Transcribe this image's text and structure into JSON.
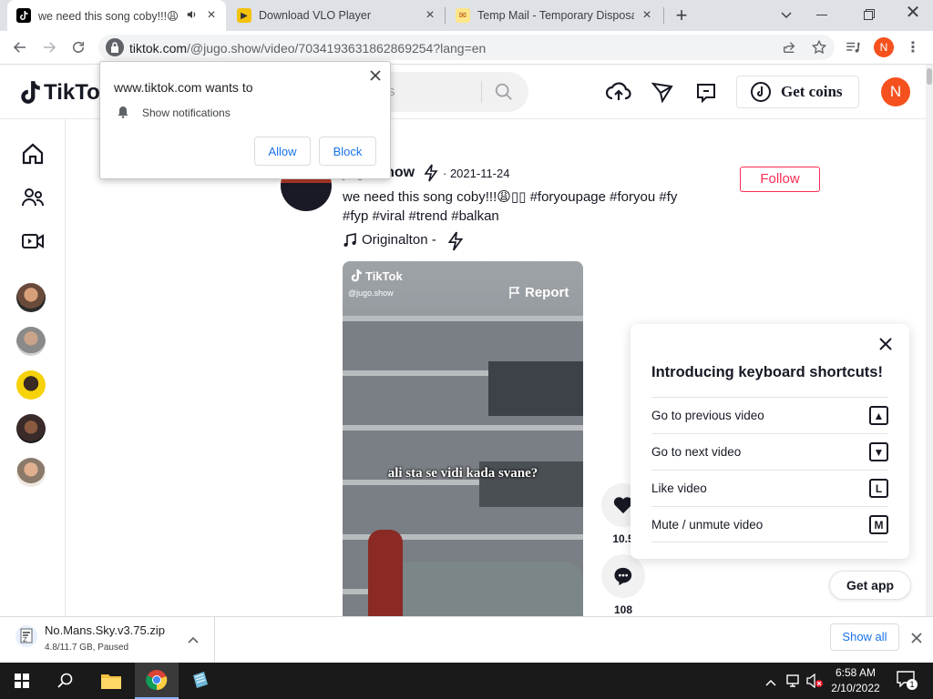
{
  "browser": {
    "tabs": [
      {
        "title": "we need this song coby!!!😩",
        "active": true
      },
      {
        "title": "Download VLO Player",
        "active": false
      },
      {
        "title": "Temp Mail - Temporary Disposab",
        "active": false
      }
    ],
    "new_tab_label": "+",
    "url_host": "tiktok.com",
    "url_path": "/@jugo.show/video/7034193631862869254?lang=en",
    "profile_initial": "N"
  },
  "notification_prompt": {
    "title": "www.tiktok.com wants to",
    "permission": "Show notifications",
    "allow_label": "Allow",
    "block_label": "Block"
  },
  "tiktok_header": {
    "logo_text": "TikTok",
    "search_placeholder": "s",
    "get_coins_label": "Get coins",
    "user_initial": "N"
  },
  "post": {
    "author_partial": "jugo.show",
    "date": "· 2021-11-24",
    "follow_label": "Follow",
    "caption_line1": "we need this song coby!!!😩▯▯ #foryoupage #foryou #fy",
    "caption_line2": "#fyp #viral #trend #balkan",
    "sound": "Originalton -",
    "video_watermark": "TikTok",
    "video_handle": "@jugo.show",
    "report_label": "Report",
    "subtitle": "ali sta se vidi kada svane?",
    "likes": "10.5",
    "comments": "108"
  },
  "shortcuts": {
    "title": "Introducing keyboard shortcuts!",
    "items": [
      {
        "label": "Go to previous video",
        "key": "▲"
      },
      {
        "label": "Go to next video",
        "key": "▼"
      },
      {
        "label": "Like video",
        "key": "L"
      },
      {
        "label": "Mute / unmute video",
        "key": "M"
      }
    ]
  },
  "get_app_label": "Get app",
  "download": {
    "filename": "No.Mans.Sky.v3.75.zip",
    "status": "4.8/11.7 GB, Paused",
    "show_all_label": "Show all"
  },
  "taskbar": {
    "time": "6:58 AM",
    "date": "2/10/2022",
    "notification_count": "1"
  },
  "colors": {
    "tiktok_red": "#fe2c55",
    "avatar_orange": "#f5511e",
    "chrome_tabbar": "#dee1e6"
  }
}
